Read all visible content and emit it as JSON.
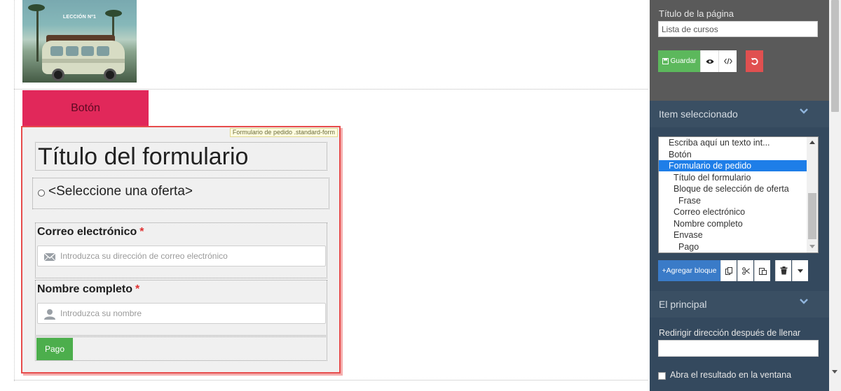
{
  "canvas": {
    "lesson_image": {
      "label": "LECCIÓN Nº1"
    },
    "button_block": {
      "label": "Botón"
    },
    "order_form": {
      "badge": "Formulario de pedido .standard-form",
      "title": "Título del formulario",
      "offer_text": "<Seleccione una oferta>",
      "email": {
        "label": "Correo electrónico",
        "required_mark": "*",
        "placeholder": "Introduzca su dirección de correo electrónico",
        "icon": "envelope-icon"
      },
      "name": {
        "label": "Nombre completo",
        "required_mark": "*",
        "placeholder": "Introduzca su nombre",
        "icon": "person-icon"
      },
      "pay_button": "Pago"
    }
  },
  "panel": {
    "page_title_label": "Título de la página",
    "page_title_value": "Lista de cursos",
    "save_label": "Guardar",
    "section_selected": "Item seleccionado",
    "tree_items": [
      {
        "label": "Escriba aquí un texto int...",
        "level": 2,
        "selected": false
      },
      {
        "label": "Botón",
        "level": 2,
        "selected": false
      },
      {
        "label": "Formulario de pedido",
        "level": 2,
        "selected": true
      },
      {
        "label": "Título del formulario",
        "level": 3,
        "selected": false
      },
      {
        "label": "Bloque de selección de oferta",
        "level": 3,
        "selected": false
      },
      {
        "label": "Frase",
        "level": 4,
        "selected": false
      },
      {
        "label": "Correo electrónico",
        "level": 3,
        "selected": false
      },
      {
        "label": "Nombre completo",
        "level": 3,
        "selected": false
      },
      {
        "label": "Envase",
        "level": 3,
        "selected": false
      },
      {
        "label": "Pago",
        "level": 4,
        "selected": false
      }
    ],
    "add_block_label": "+Agregar bloque",
    "section_main": "El principal",
    "redirect_label": "Redirigir dirección después de llenar",
    "redirect_value": "",
    "open_result_label": "Abra el resultado en la ventana"
  },
  "colors": {
    "panel_bg": "#34495e",
    "accent_blue": "#3a7bc8",
    "save_green": "#5cb85c",
    "undo_red": "#e05050",
    "button_block": "#e1285a",
    "form_border": "#e74c4c",
    "pay_green": "#4cae4c",
    "tree_selected": "#1e7ee8"
  }
}
